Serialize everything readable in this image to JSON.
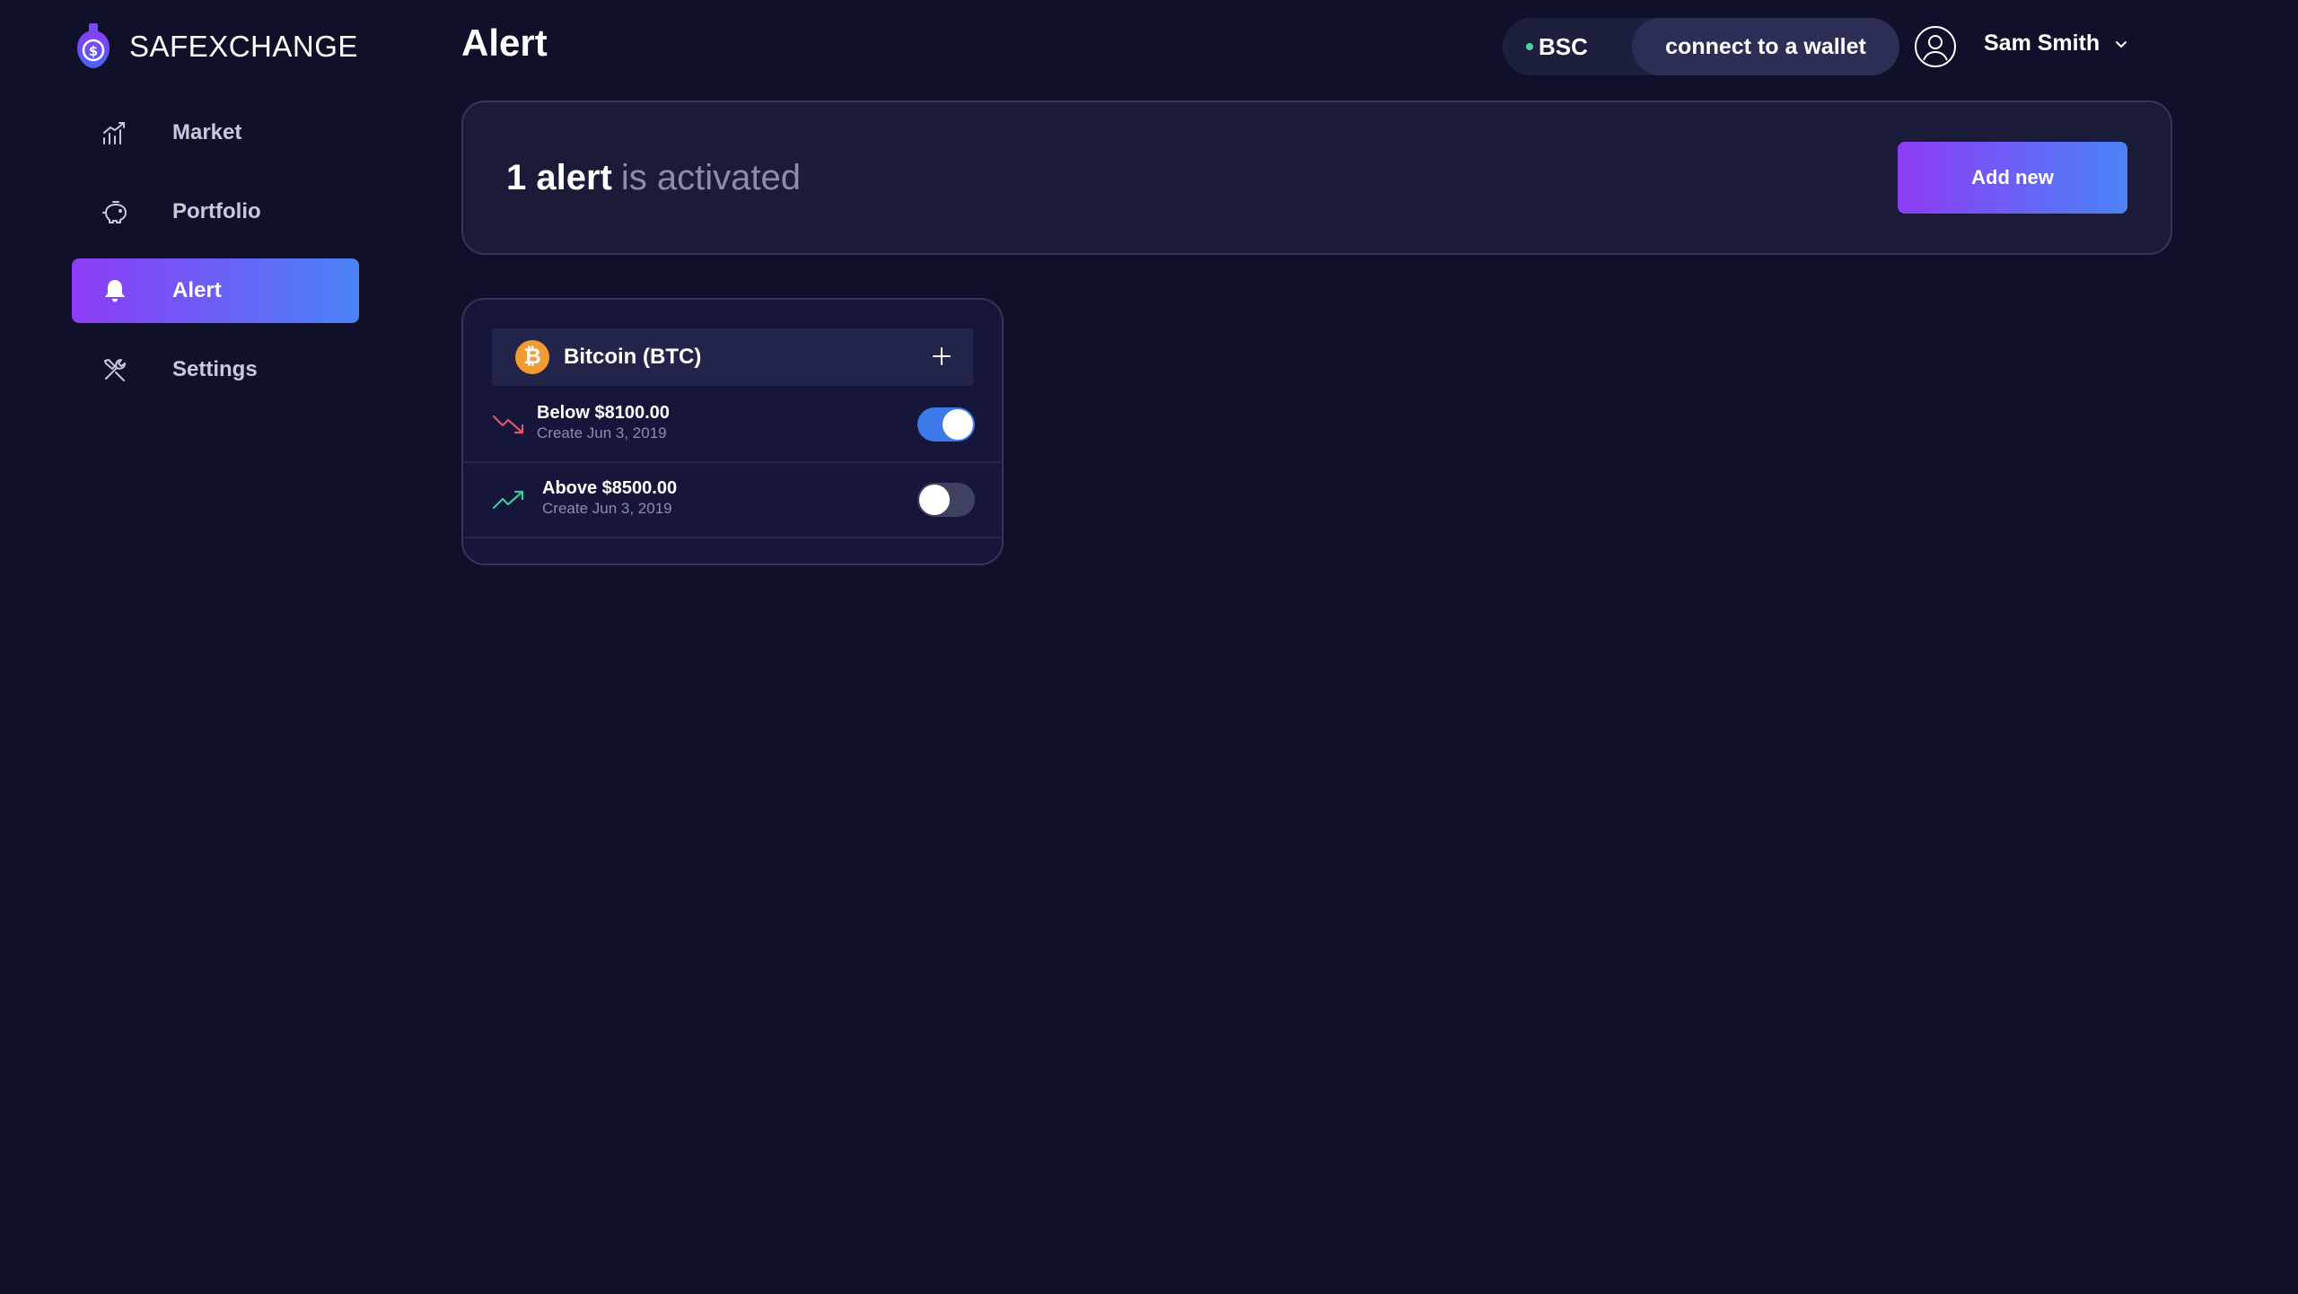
{
  "brand": {
    "name": "SAFEXCHANGE",
    "logo_icon": "shield-dollar-icon"
  },
  "sidebar": {
    "items": [
      {
        "label": "Market",
        "icon": "chart-icon",
        "active": false
      },
      {
        "label": "Portfolio",
        "icon": "piggy-bank-icon",
        "active": false
      },
      {
        "label": "Alert",
        "icon": "bell-icon",
        "active": true
      },
      {
        "label": "Settings",
        "icon": "tools-icon",
        "active": false
      }
    ]
  },
  "header": {
    "title": "Alert",
    "network": "BSC",
    "connect_label": "connect to a wallet",
    "user_name": "Sam Smith"
  },
  "summary": {
    "count_text": "1 alert",
    "status_text": "is activated",
    "add_label": "Add new"
  },
  "card": {
    "coin_symbol_glyph": "₿",
    "coin_name": "Bitcoin (BTC)",
    "alerts": [
      {
        "title": "Below $8100.00",
        "date": "Create Jun 3, 2019",
        "direction": "down",
        "enabled": true
      },
      {
        "title": "Above $8500.00",
        "date": "Create Jun 3, 2019",
        "direction": "up",
        "enabled": false
      }
    ]
  },
  "colors": {
    "background": "#0f1029",
    "accent_start": "#8d3cf6",
    "accent_end": "#4a83f7",
    "down": "#e0566b",
    "up": "#3fc99a",
    "toggle_on": "#3b7ae8"
  }
}
